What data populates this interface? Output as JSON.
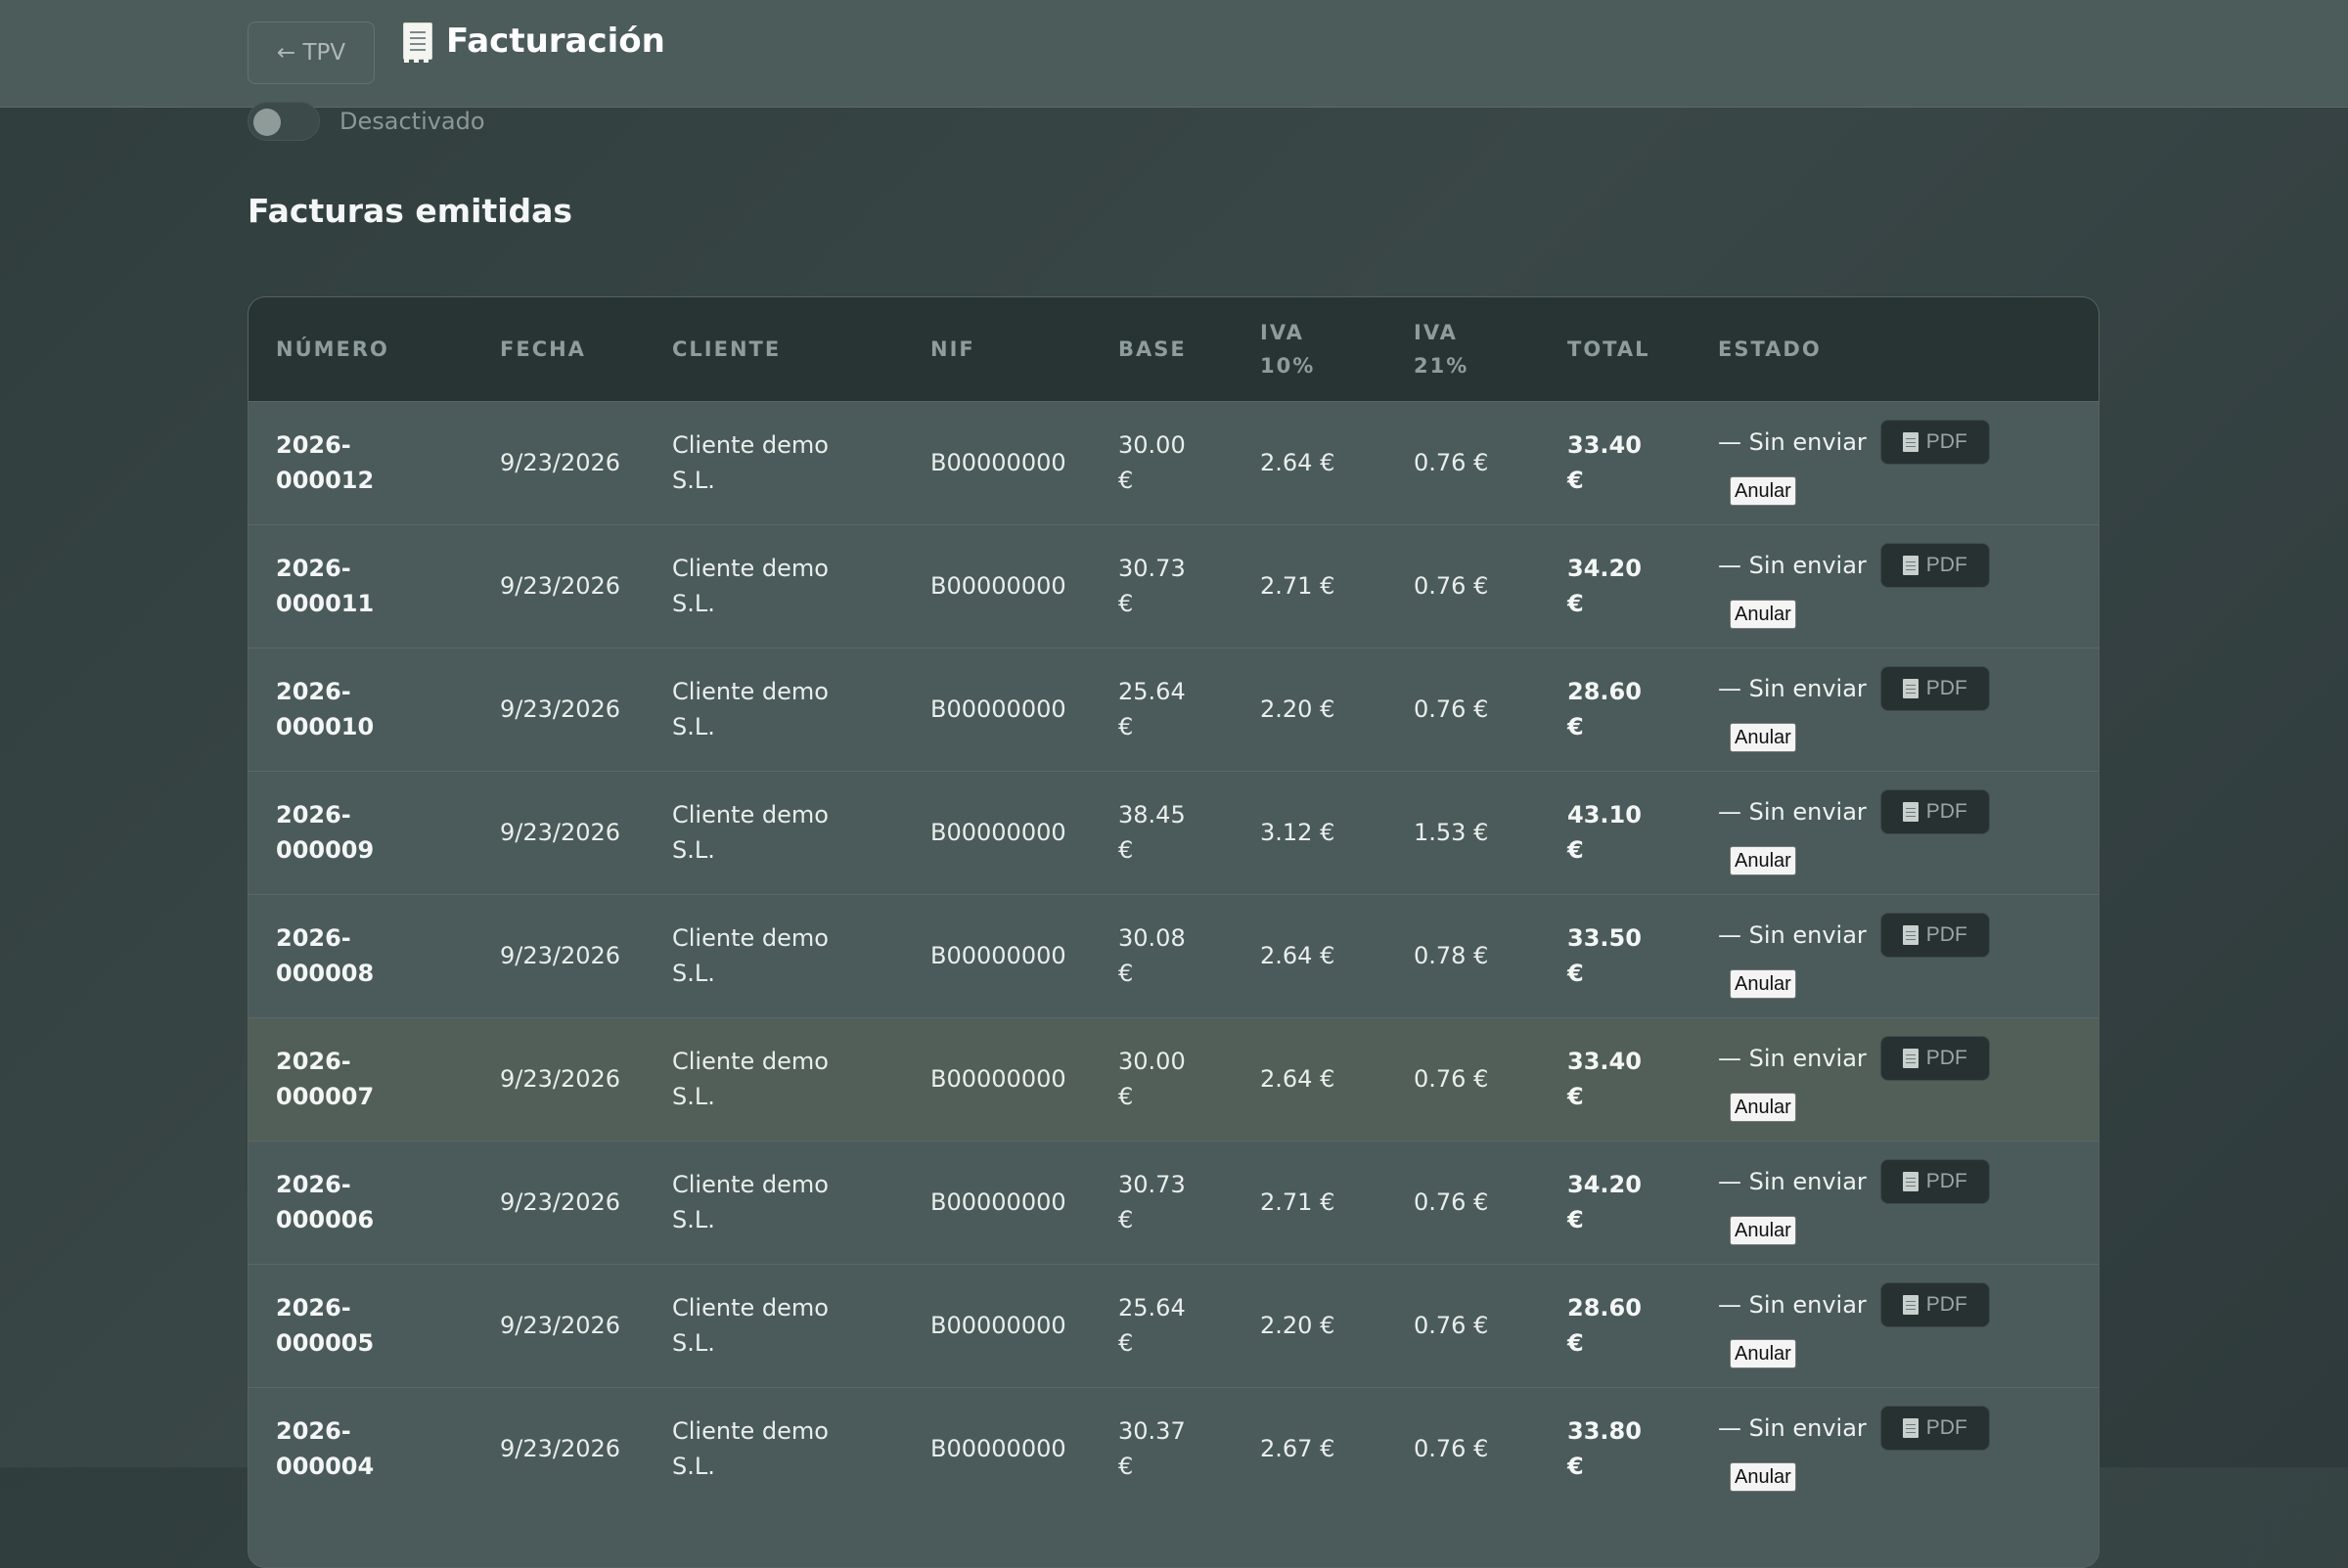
{
  "header": {
    "back_label": "← TPV",
    "title": "Facturación",
    "title_icon": "receipt-icon"
  },
  "toggle": {
    "label": "Desactivado",
    "state": "off"
  },
  "section": {
    "title": "Facturas emitidas"
  },
  "table": {
    "columns": [
      [
        "NÚMERO"
      ],
      [
        "FECHA"
      ],
      [
        "CLIENTE"
      ],
      [
        "NIF"
      ],
      [
        "BASE"
      ],
      [
        "IVA",
        "10%"
      ],
      [
        "IVA",
        "21%"
      ],
      [
        "TOTAL"
      ],
      [
        "ESTADO"
      ]
    ],
    "rows": [
      {
        "numero": [
          "2026-",
          "000012"
        ],
        "fecha": "9/23/2026",
        "cliente": [
          "Cliente demo",
          "S.L."
        ],
        "nif": "B00000000",
        "base": [
          "30.00",
          "€"
        ],
        "iva10": "2.64 €",
        "iva21": "0.76 €",
        "total": [
          "33.40",
          "€"
        ],
        "estado": "— Sin enviar",
        "pdf": "PDF",
        "anular": "Anular"
      },
      {
        "numero": [
          "2026-",
          "000011"
        ],
        "fecha": "9/23/2026",
        "cliente": [
          "Cliente demo",
          "S.L."
        ],
        "nif": "B00000000",
        "base": [
          "30.73",
          "€"
        ],
        "iva10": "2.71 €",
        "iva21": "0.76 €",
        "total": [
          "34.20",
          "€"
        ],
        "estado": "— Sin enviar",
        "pdf": "PDF",
        "anular": "Anular"
      },
      {
        "numero": [
          "2026-",
          "000010"
        ],
        "fecha": "9/23/2026",
        "cliente": [
          "Cliente demo",
          "S.L."
        ],
        "nif": "B00000000",
        "base": [
          "25.64",
          "€"
        ],
        "iva10": "2.20 €",
        "iva21": "0.76 €",
        "total": [
          "28.60",
          "€"
        ],
        "estado": "— Sin enviar",
        "pdf": "PDF",
        "anular": "Anular"
      },
      {
        "numero": [
          "2026-",
          "000009"
        ],
        "fecha": "9/23/2026",
        "cliente": [
          "Cliente demo",
          "S.L."
        ],
        "nif": "B00000000",
        "base": [
          "38.45",
          "€"
        ],
        "iva10": "3.12 €",
        "iva21": "1.53 €",
        "total": [
          "43.10",
          "€"
        ],
        "estado": "— Sin enviar",
        "pdf": "PDF",
        "anular": "Anular"
      },
      {
        "numero": [
          "2026-",
          "000008"
        ],
        "fecha": "9/23/2026",
        "cliente": [
          "Cliente demo",
          "S.L."
        ],
        "nif": "B00000000",
        "base": [
          "30.08",
          "€"
        ],
        "iva10": "2.64 €",
        "iva21": "0.78 €",
        "total": [
          "33.50",
          "€"
        ],
        "estado": "— Sin enviar",
        "pdf": "PDF",
        "anular": "Anular"
      },
      {
        "numero": [
          "2026-",
          "000007"
        ],
        "fecha": "9/23/2026",
        "cliente": [
          "Cliente demo",
          "S.L."
        ],
        "nif": "B00000000",
        "base": [
          "30.00",
          "€"
        ],
        "iva10": "2.64 €",
        "iva21": "0.76 €",
        "total": [
          "33.40",
          "€"
        ],
        "estado": "— Sin enviar",
        "pdf": "PDF",
        "anular": "Anular",
        "highlighted": true
      },
      {
        "numero": [
          "2026-",
          "000006"
        ],
        "fecha": "9/23/2026",
        "cliente": [
          "Cliente demo",
          "S.L."
        ],
        "nif": "B00000000",
        "base": [
          "30.73",
          "€"
        ],
        "iva10": "2.71 €",
        "iva21": "0.76 €",
        "total": [
          "34.20",
          "€"
        ],
        "estado": "— Sin enviar",
        "pdf": "PDF",
        "anular": "Anular"
      },
      {
        "numero": [
          "2026-",
          "000005"
        ],
        "fecha": "9/23/2026",
        "cliente": [
          "Cliente demo",
          "S.L."
        ],
        "nif": "B00000000",
        "base": [
          "25.64",
          "€"
        ],
        "iva10": "2.20 €",
        "iva21": "0.76 €",
        "total": [
          "28.60",
          "€"
        ],
        "estado": "— Sin enviar",
        "pdf": "PDF",
        "anular": "Anular"
      },
      {
        "numero": [
          "2026-",
          "000004"
        ],
        "fecha": "9/23/2026",
        "cliente": [
          "Cliente demo",
          "S.L."
        ],
        "nif": "B00000000",
        "base": [
          "30.37",
          "€"
        ],
        "iva10": "2.67 €",
        "iva21": "0.76 €",
        "total": [
          "33.80",
          "€"
        ],
        "estado": "— Sin enviar",
        "pdf": "PDF",
        "anular": "Anular"
      }
    ]
  }
}
